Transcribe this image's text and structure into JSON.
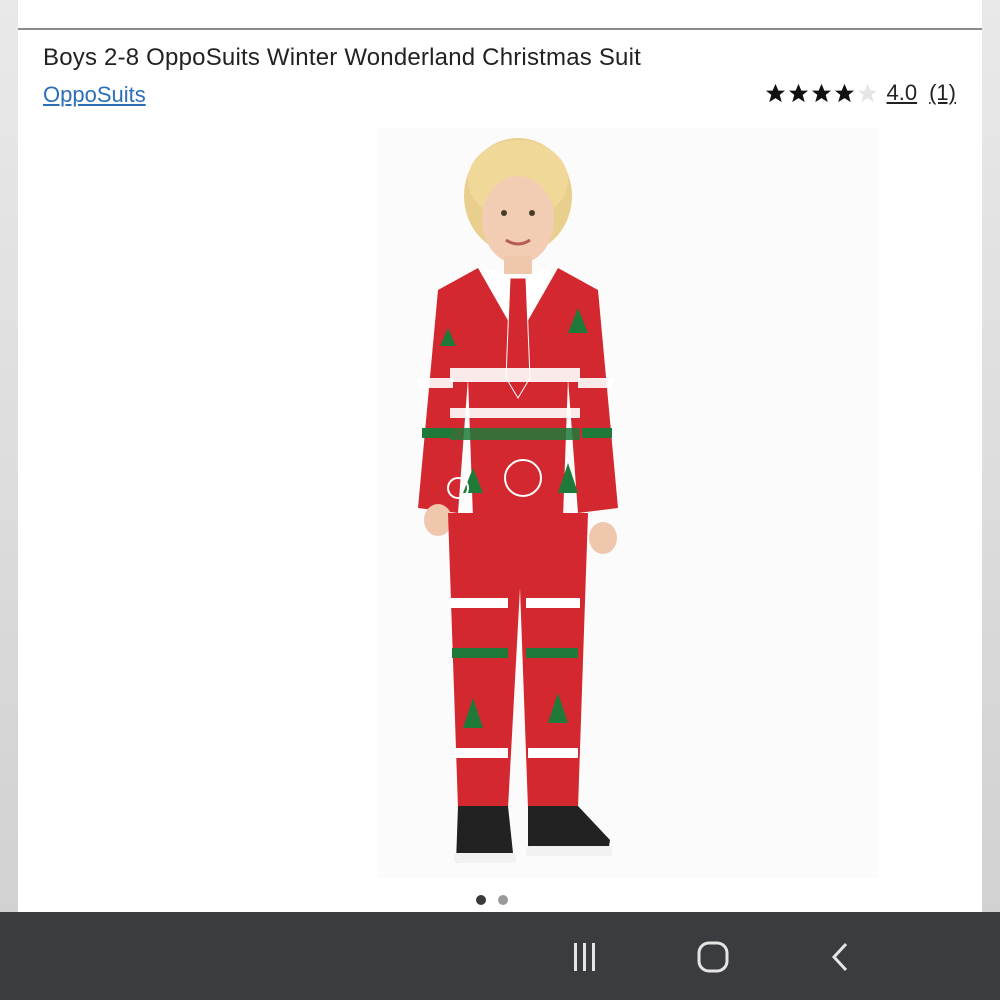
{
  "product": {
    "title": "Boys 2-8 OppoSuits Winter Wonderland Christmas Suit",
    "brand": "OppoSuits",
    "rating": {
      "value": "4.0",
      "count": "(1)",
      "stars_filled": 4,
      "stars_total": 5
    }
  },
  "carousel": {
    "total": 2,
    "active_index": 0
  },
  "nav": {
    "recents_icon": "recents-icon",
    "home_icon": "home-icon",
    "back_icon": "back-icon"
  },
  "colors": {
    "link": "#2a6fb8",
    "suit_red": "#d3282f",
    "tree_green": "#1f7a3a",
    "navbar": "#3b3c40"
  }
}
